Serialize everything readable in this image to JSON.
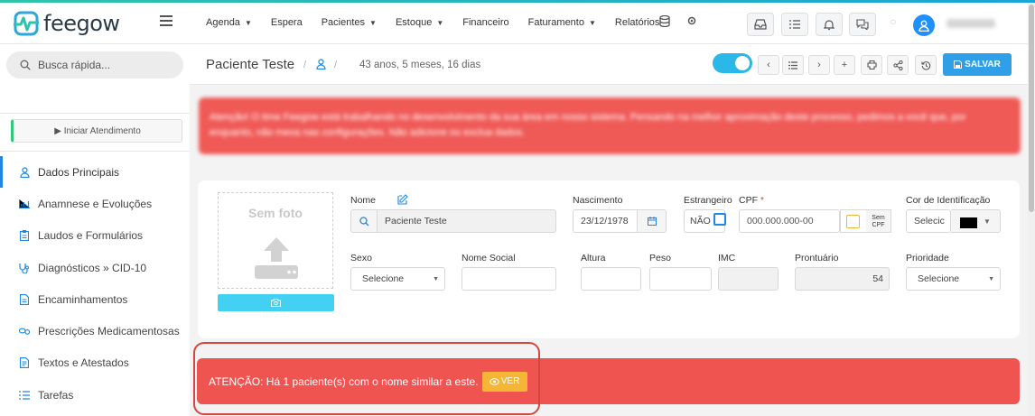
{
  "brand": {
    "name": "feegow"
  },
  "topnav": {
    "items": [
      {
        "label": "Agenda",
        "has_caret": true
      },
      {
        "label": "Espera",
        "has_caret": false
      },
      {
        "label": "Pacientes",
        "has_caret": true
      },
      {
        "label": "Estoque",
        "has_caret": true
      },
      {
        "label": "Financeiro",
        "has_caret": false
      },
      {
        "label": "Faturamento",
        "has_caret": true
      },
      {
        "label": "Relatórios",
        "has_caret": false
      }
    ],
    "caret": "▼"
  },
  "sidebar": {
    "search_placeholder": "Busca rápida...",
    "start_button": "▶ Iniciar Atendimento",
    "items": [
      {
        "label": "Dados Principais",
        "icon": "user-icon",
        "active": true
      },
      {
        "label": "Anamnese e Evoluções",
        "icon": "chart-icon"
      },
      {
        "label": "Laudos e Formulários",
        "icon": "clipboard-icon"
      },
      {
        "label": "Diagnósticos » CID-10",
        "icon": "stethoscope-icon"
      },
      {
        "label": "Encaminhamentos",
        "icon": "document-icon"
      },
      {
        "label": "Prescrições Medicamentosas",
        "icon": "pills-icon"
      },
      {
        "label": "Textos e Atestados",
        "icon": "file-text-icon"
      },
      {
        "label": "Tarefas",
        "icon": "tasks-icon"
      }
    ]
  },
  "header": {
    "title": "Paciente Teste",
    "separator": "/",
    "age": "43 anos, 5 meses, 16 dias",
    "save_label": "SALVAR"
  },
  "alert_top": {
    "text": "Atenção! O time Feegow está trabalhando no desenvolvimento da sua área em nosso sistema. Pensando na melhor aproximação deste processo, pedimos a você que, por enquanto, não mexa nas configurações. Não adicione ou exclua dados."
  },
  "form": {
    "photo_label": "Sem foto",
    "nome_label": "Nome",
    "nome_value": "Paciente Teste",
    "nascimento_label": "Nascimento",
    "nascimento_value": "23/12/1978",
    "estrangeiro_label": "Estrangeiro",
    "estrangeiro_value": "NÃO",
    "cpf_label": "CPF",
    "cpf_required": "*",
    "cpf_placeholder": "000.000.000-00",
    "sem_cpf": "Sem CPF",
    "cor_label": "Cor de Identificação",
    "cor_value": "Selecic",
    "sexo_label": "Sexo",
    "sexo_value": "Selecione",
    "nome_social_label": "Nome Social",
    "altura_label": "Altura",
    "peso_label": "Peso",
    "imc_label": "IMC",
    "prontuario_label": "Prontuário",
    "prontuario_value": "54",
    "prioridade_label": "Prioridade",
    "prioridade_value": "Selecione"
  },
  "alert_similar": {
    "text": "ATENÇÃO: Há 1 paciente(s) com o nome similar a este.",
    "button": "VER"
  },
  "colors": {
    "accent": "#1e88e5",
    "alert": "#ef5450",
    "toggle": "#2bb7e8",
    "warning": "#f5b636"
  }
}
